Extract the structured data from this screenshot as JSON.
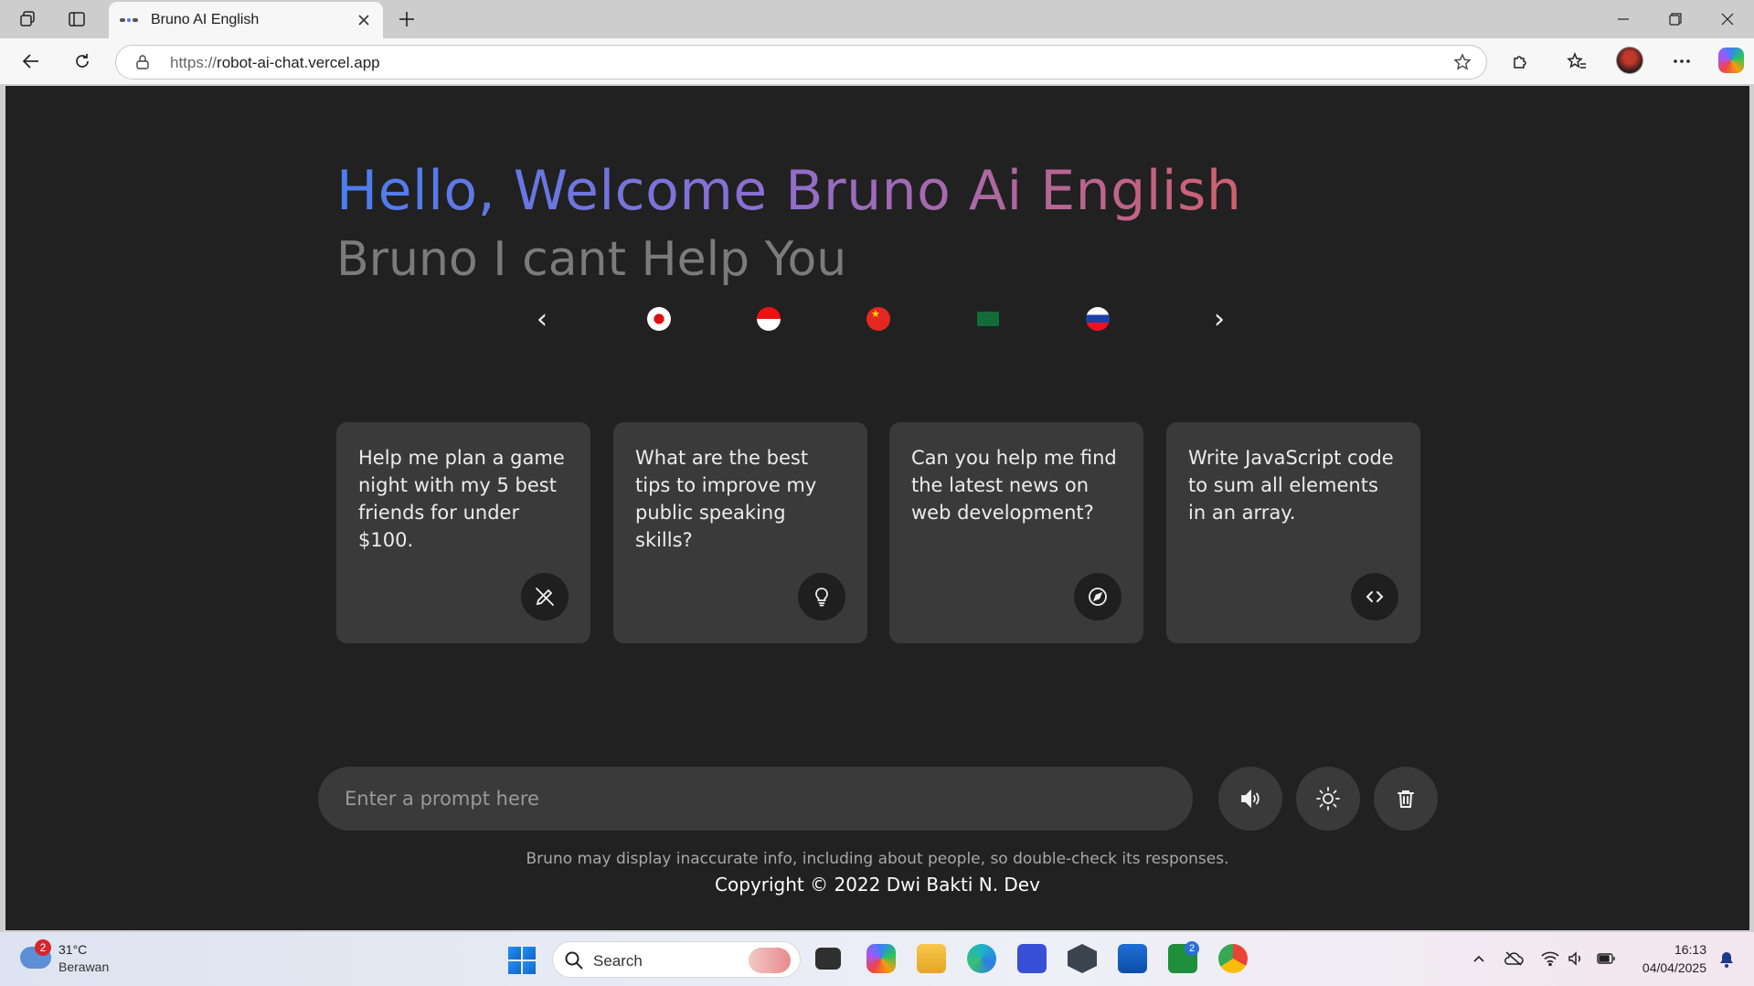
{
  "browser": {
    "tab_title": "Bruno AI English",
    "url_scheme": "https://",
    "url_host": "robot-ai-chat.vercel.app"
  },
  "hero": {
    "title": "Hello, Welcome Bruno Ai English",
    "subtitle": "Bruno I cant Help You"
  },
  "flags": {
    "prev_label": "‹",
    "next_label": "›",
    "items": [
      "japan-flag",
      "indonesia-flag",
      "china-flag",
      "saudi-arabia-flag",
      "russia-flag"
    ]
  },
  "cards": [
    {
      "text": "Help me plan a game night with my 5 best friends for under $100.",
      "icon": "pen-icon"
    },
    {
      "text": "What are the best tips to improve my public speaking skills?",
      "icon": "lightbulb-icon"
    },
    {
      "text": "Can you help me find the latest news on web development?",
      "icon": "compass-icon"
    },
    {
      "text": "Write JavaScript code to sum all elements in an array.",
      "icon": "code-icon"
    }
  ],
  "prompt": {
    "placeholder": "Enter a prompt here"
  },
  "footer": {
    "disclaimer": "Bruno may display inaccurate info, including about people, so double-check its responses.",
    "copyright": "Copyright © 2022 Dwi Bakti N. Dev"
  },
  "taskbar": {
    "weather_badge": "2",
    "temperature": "31°C",
    "condition": "Berawan",
    "search_label": "Search",
    "xbox_badge": "2",
    "time": "16:13",
    "date": "04/04/2025"
  },
  "colors": {
    "page_bg": "#212121",
    "card_bg": "#3a3a3a",
    "title_gradient_start": "#4a7ef0",
    "title_gradient_end": "#d0606f"
  }
}
